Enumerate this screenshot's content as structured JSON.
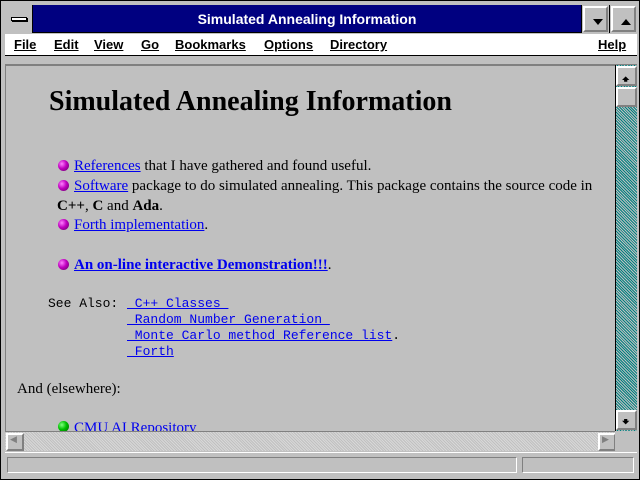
{
  "window": {
    "title": "Simulated Annealing Information"
  },
  "menu": {
    "items": [
      {
        "label": "File"
      },
      {
        "label": "Edit"
      },
      {
        "label": "View"
      },
      {
        "label": "Go"
      },
      {
        "label": "Bookmarks"
      },
      {
        "label": "Options"
      },
      {
        "label": "Directory"
      },
      {
        "label": "Help"
      }
    ]
  },
  "page": {
    "heading": "Simulated Annealing Information",
    "items": [
      {
        "link": "References",
        "text": " that I have gathered and found useful."
      },
      {
        "link": "Software",
        "text": " package to do simulated annealing. This package contains the source code in"
      },
      {
        "link": "Forth implementation",
        "text": "."
      },
      {
        "link": "An on-line interactive Demonstration!!!",
        "text": "."
      }
    ],
    "software_line2": {
      "a": "C++",
      "sep1": ", ",
      "b": "C",
      "sep2": " and ",
      "c": "Ada",
      "end": "."
    },
    "see_also": {
      "label": "See Also:",
      "links": [
        " C++ Classes ",
        " Random Number Generation ",
        " Monte Carlo method Reference list",
        " Forth"
      ],
      "after_third": "."
    },
    "elsewhere_label": "And (elsewhere):",
    "elsewhere_items": [
      {
        "link": "CMU AI Repository"
      }
    ]
  },
  "colors": {
    "titlebar": "#000080",
    "link": "#0000ee",
    "background": "#c0c0c0",
    "scroll_track": "#008080"
  },
  "icons": {
    "system_menu": "system-menu-icon",
    "minimize": "minimize-icon",
    "maximize": "maximize-icon",
    "bullet_magenta": "magenta-ball-bullet",
    "bullet_green": "green-ball-bullet",
    "scroll_up": "arrow-up-icon",
    "scroll_down": "arrow-down-icon",
    "scroll_left": "arrow-left-icon",
    "scroll_right": "arrow-right-icon"
  }
}
